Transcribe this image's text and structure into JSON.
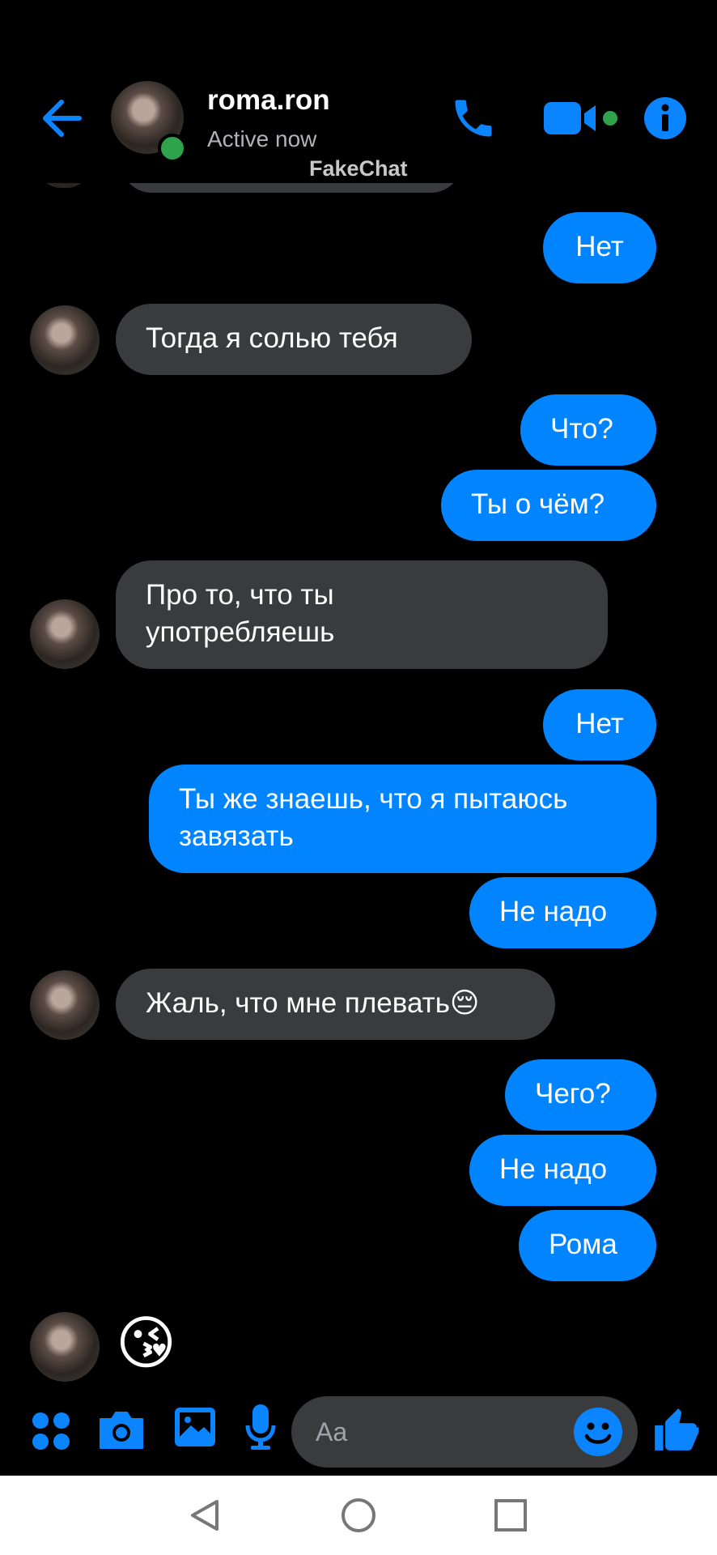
{
  "header": {
    "contact_name": "roma.ron",
    "status": "Active now",
    "watermark": "FakeChat"
  },
  "messages": [
    {
      "from": "me",
      "text": "Нет"
    },
    {
      "from": "them",
      "text": "Тогда я солью тебя"
    },
    {
      "from": "me",
      "text": "Что?"
    },
    {
      "from": "me",
      "text": "Ты о чём?"
    },
    {
      "from": "them",
      "text": "Про то, что ты употребляешь"
    },
    {
      "from": "me",
      "text": "Нет"
    },
    {
      "from": "me",
      "text": "Ты же знаешь, что я пытаюсь завязать"
    },
    {
      "from": "me",
      "text": "Не надо"
    },
    {
      "from": "them",
      "text": "Жаль, что мне плевать😔"
    },
    {
      "from": "me",
      "text": "Чего?"
    },
    {
      "from": "me",
      "text": "Не надо"
    },
    {
      "from": "me",
      "text": "Рома"
    },
    {
      "from": "them",
      "text": "😘"
    }
  ],
  "composer": {
    "placeholder": "Aa"
  },
  "colors": {
    "accent": "#0084ff",
    "incoming_bubble": "#3a3b3c",
    "online": "#31a24c",
    "background": "#000000"
  },
  "icons": [
    "back-arrow-icon",
    "phone-icon",
    "video-camera-icon",
    "info-icon",
    "apps-icon",
    "camera-icon",
    "gallery-icon",
    "microphone-icon",
    "emoji-icon",
    "thumbs-up-icon",
    "nav-back-icon",
    "nav-home-icon",
    "nav-recents-icon"
  ]
}
